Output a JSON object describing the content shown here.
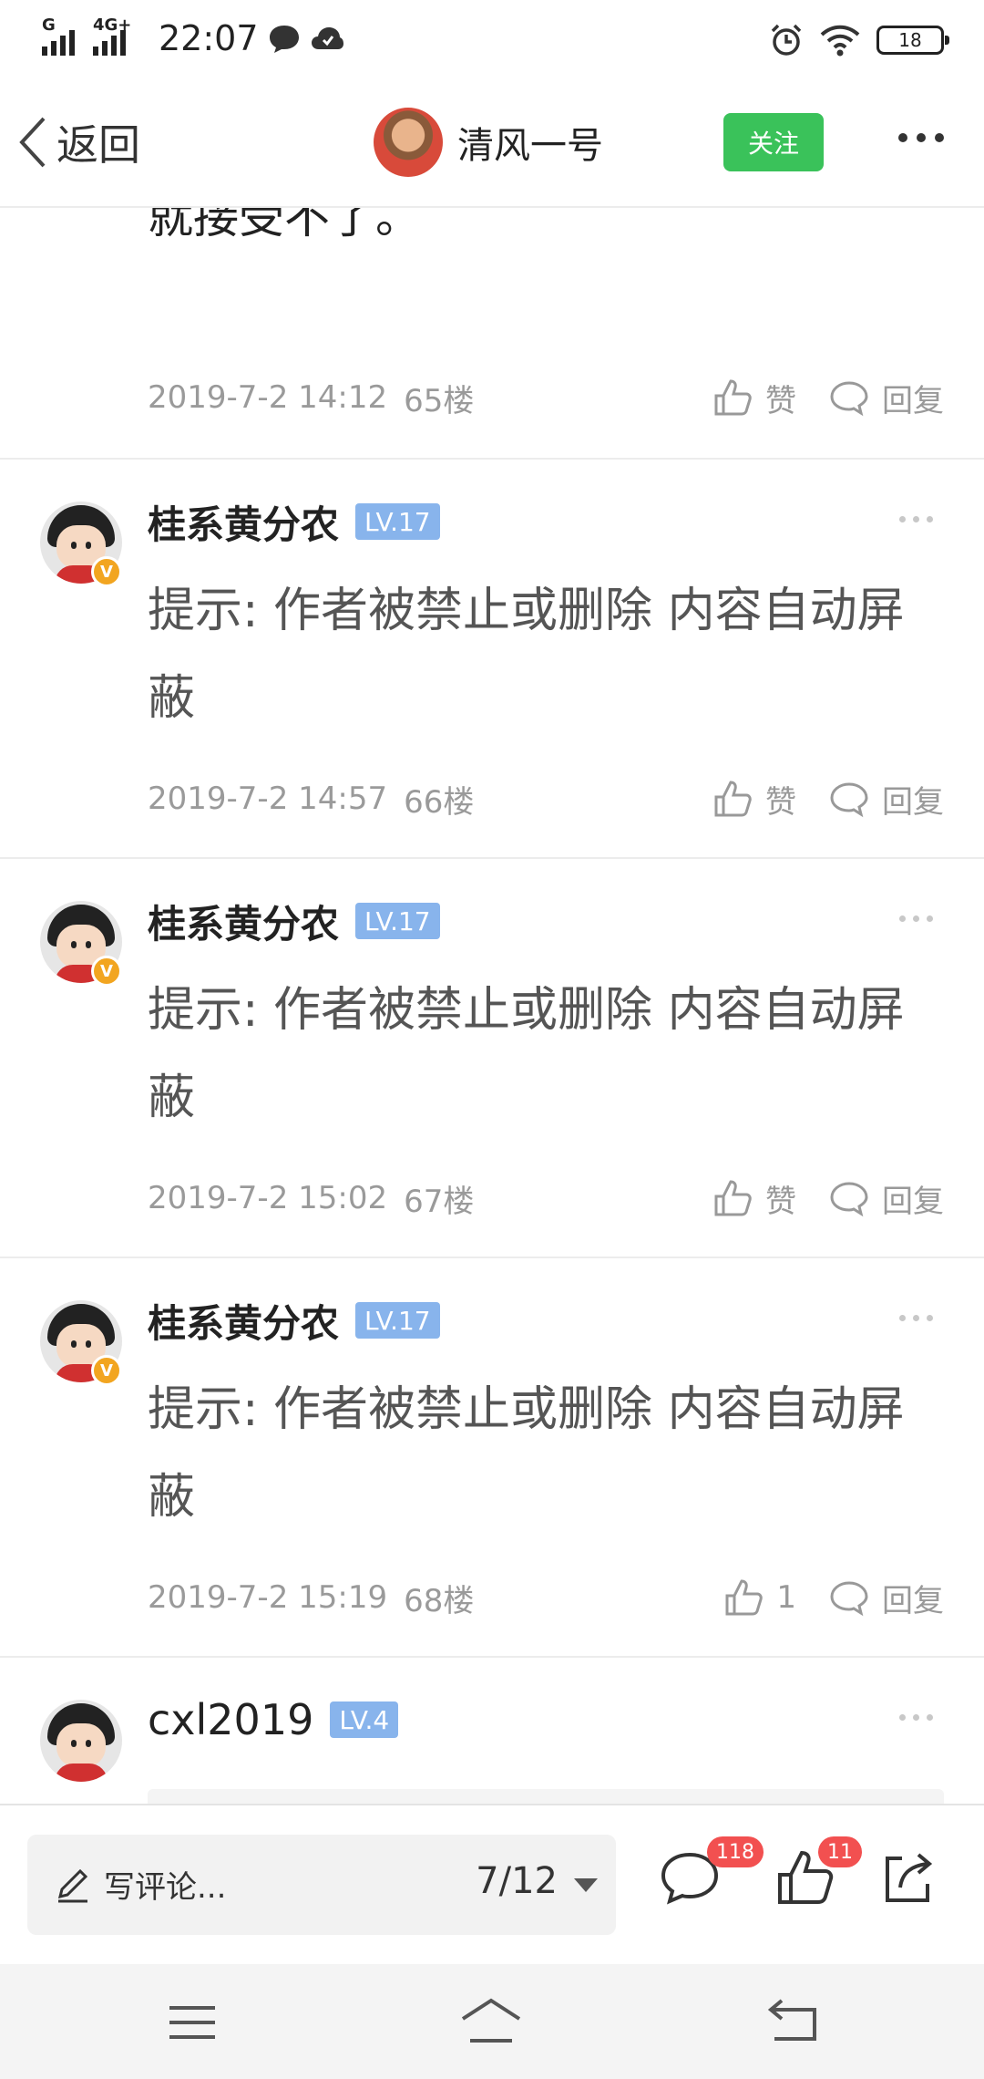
{
  "status_bar": {
    "network": "G",
    "network2": "4G+",
    "time": "22:07",
    "battery": "18",
    "icons": [
      "signal-icon",
      "message-icon",
      "cloud-icon",
      "alarm-icon",
      "wifi-icon",
      "battery-icon"
    ]
  },
  "nav": {
    "back_label": "返回",
    "author_name": "清风一号",
    "follow_label": "关注"
  },
  "prev_post": {
    "text_tail": "就接受不了。",
    "time": "2019-7-2 14:12",
    "floor": "65楼",
    "like_label": "赞",
    "reply_label": "回复"
  },
  "comments": [
    {
      "username": "桂系黄分农",
      "level": "LV.17",
      "text": "提示: 作者被禁止或删除 内容自动屏蔽",
      "time": "2019-7-2 14:57",
      "floor": "66楼",
      "like_label": "赞",
      "reply_label": "回复"
    },
    {
      "username": "桂系黄分农",
      "level": "LV.17",
      "text": "提示: 作者被禁止或删除 内容自动屏蔽",
      "time": "2019-7-2 15:02",
      "floor": "67楼",
      "like_label": "赞",
      "reply_label": "回复"
    },
    {
      "username": "桂系黄分农",
      "level": "LV.17",
      "text": "提示: 作者被禁止或删除 内容自动屏蔽",
      "time": "2019-7-2 15:19",
      "floor": "68楼",
      "like_label": "1",
      "reply_label": "回复"
    },
    {
      "username": "cxl2019",
      "level": "LV.4"
    }
  ],
  "bottom_bar": {
    "comment_placeholder": "写评论...",
    "page_indicator": "7/12",
    "comment_count": "118",
    "like_count": "11"
  },
  "colors": {
    "follow_green": "#3ac25a",
    "level_blue": "#88b4ec",
    "badge_red": "#f25050",
    "verified_orange": "#f2a520"
  }
}
